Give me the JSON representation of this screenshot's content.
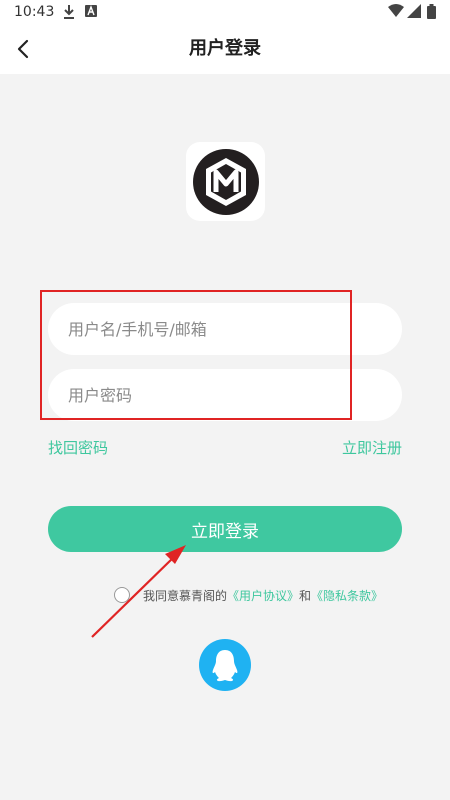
{
  "status_bar": {
    "time": "10:43",
    "icons": [
      "download-icon",
      "a-icon",
      "wifi-icon",
      "signal-icon",
      "battery-icon"
    ]
  },
  "header": {
    "title": "用户登录",
    "back_icon": "chevron-left-icon"
  },
  "logo": {
    "letter": "M"
  },
  "form": {
    "username_placeholder": "用户名/手机号/邮箱",
    "password_placeholder": "用户密码",
    "username_value": "",
    "password_value": ""
  },
  "links": {
    "forgot_password": "找回密码",
    "register": "立即注册"
  },
  "login_button": "立即登录",
  "agreement": {
    "prefix": "我同意慕青阁的",
    "user_agreement": "《用户协议》",
    "conjunction": "和",
    "privacy_policy": "《隐私条款》",
    "checked": false
  },
  "social_login": {
    "icon": "qq-icon"
  },
  "colors": {
    "accent": "#3fc8a0",
    "link": "#3ec79e",
    "annotation": "#e02424",
    "qq": "#1fb2f2",
    "background": "#f3f3f3"
  }
}
